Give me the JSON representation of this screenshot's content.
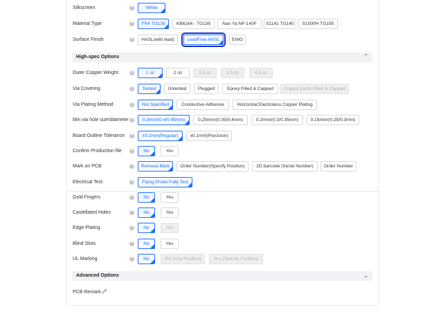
{
  "rows": {
    "silkscreen": {
      "label": "Silkscreen",
      "options": [
        "White"
      ]
    },
    "material": {
      "label": "Material Type",
      "options": [
        "FR4 TG135",
        "KB6164 - TG135",
        "Nan Ya NP-140F",
        "S1141 TG140",
        "S1000H TG155"
      ]
    },
    "finish": {
      "label": "Surface Finish",
      "options": [
        "HASL(with lead)",
        "LeadFree HASL",
        "ENIG"
      ]
    },
    "copper": {
      "label": "Outer Copper Weight",
      "options": [
        "1 oz",
        "2 oz",
        "2.5 oz",
        "3.5 oz",
        "4.5 oz"
      ]
    },
    "via_cover": {
      "label": "Via Covering",
      "options": [
        "Tented",
        "Untented",
        "Plugged",
        "Epoxy Filled & Capped",
        "Copper paste Filled & Capped"
      ]
    },
    "via_plating": {
      "label": "Via Plating Method",
      "options": [
        "Not Specified",
        "Conductive Adhesive",
        "Horizontal Electroless Copper Plating"
      ]
    },
    "min_via": {
      "label": "Min via hole size/diameter",
      "options": [
        "0.3mm/(0.4/0.45mm)",
        "0.25mm/(0.35/0.4mm)",
        "0.2mm/(0.3/0.35mm)",
        "0.15mm/(0.25/0.3mm)"
      ]
    },
    "outline_tol": {
      "label": "Board Outline Tolerance",
      "options": [
        "±0.2mm(Regular)",
        "±0.1mm(Precision)"
      ]
    },
    "confirm": {
      "label": "Confirm Production file",
      "options": [
        "No",
        "Yes"
      ]
    },
    "mark": {
      "label": "Mark on PCB",
      "options": [
        "Remove Mark",
        "Order Number(Specify Position)",
        "2D barcode (Serial Number)",
        "Order Number"
      ]
    },
    "etest": {
      "label": "Electrical Test",
      "options": [
        "Flying Probe Fully Test"
      ]
    },
    "gold": {
      "label": "Gold Fingers",
      "options": [
        "No",
        "Yes"
      ]
    },
    "castellated": {
      "label": "Castellated Holes",
      "options": [
        "No",
        "Yes"
      ]
    },
    "edge": {
      "label": "Edge Plating",
      "options": [
        "No",
        "Yes"
      ]
    },
    "blind": {
      "label": "Blind Slots",
      "options": [
        "No",
        "Yes"
      ]
    },
    "ul": {
      "label": "UL Marking",
      "options": [
        "No",
        "Yes (Any Position)",
        "Yes (Specify Position)"
      ]
    }
  },
  "sections": {
    "high_spec": {
      "title": "High-spec Options",
      "state": "expanded"
    },
    "advanced": {
      "title": "Advanced Options",
      "state": "collapsed"
    }
  },
  "remark": {
    "label": "PCB Remark"
  },
  "icons": {
    "help": "help-circle-icon",
    "chevron_up": "chevron-up-icon",
    "chevron_down": "chevron-down-icon",
    "edit": "pencil-icon"
  },
  "colors": {
    "accent": "#1e6fff",
    "focus_outline": "#1a2fc9",
    "section_bg": "#f1f2f5",
    "disabled_bg": "#eeeeee"
  }
}
